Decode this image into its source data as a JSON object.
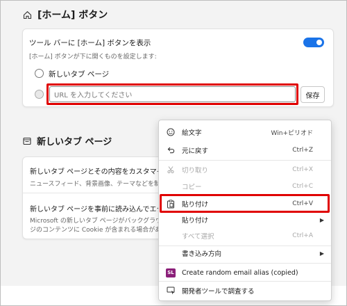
{
  "home_section": {
    "title": "[ホーム] ボタン",
    "card": {
      "toggle_label": "ツール バーに [ホーム] ボタンを表示",
      "description": "[ホーム] ボタンが下に開くものを設定します:",
      "option_new_tab": "新しいタブ ページ",
      "url_placeholder": "URL を入力してください",
      "save_label": "保存"
    }
  },
  "newtab_section": {
    "title": "新しいタブ ページ",
    "row1_title": "新しいタブ ページとその内容をカスタマイズする",
    "row1_sub": "ニュースフィード、背景画像、テーマなどを制御します",
    "row2_title": "新しいタブ ページを事前に読み込んでエクスペ",
    "row2_sub1": "Microsoft の新しいタブ ページがバックグラウンドで関が",
    "row2_sub2": "ジのコンテンツに Cookie が含まれる場合があります。"
  },
  "context_menu": {
    "emoji": {
      "label": "絵文字",
      "shortcut": "Win+ピリオド"
    },
    "undo": {
      "label": "元に戻す",
      "shortcut": "Ctrl+Z"
    },
    "cut": {
      "label": "切り取り",
      "shortcut": "Ctrl+X"
    },
    "copy": {
      "label": "コピー",
      "shortcut": "Ctrl+C"
    },
    "paste": {
      "label": "貼り付け",
      "shortcut": "Ctrl+V"
    },
    "paste_as": {
      "label": "貼り付け"
    },
    "select_all": {
      "label": "すべて選択",
      "shortcut": "Ctrl+A"
    },
    "writing_direction": {
      "label": "書き込み方向"
    },
    "extension": {
      "label": "Create random email alias (copied)",
      "badge": "SL"
    },
    "devtools": {
      "label": "開発者ツールで調査する"
    }
  },
  "colors": {
    "accent": "#1a73e8",
    "highlight": "#e00000"
  }
}
